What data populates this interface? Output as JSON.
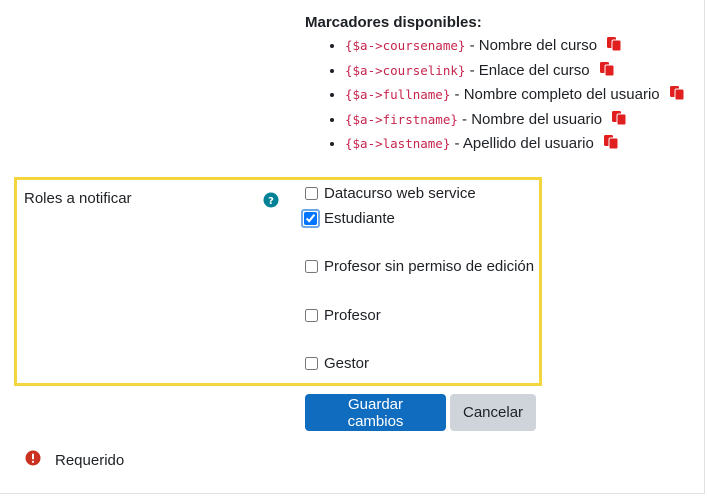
{
  "placeholders": {
    "title": "Marcadores disponibles:",
    "items": [
      {
        "code": "{$a->coursename}",
        "desc": " - Nombre del curso"
      },
      {
        "code": "{$a->courselink}",
        "desc": " - Enlace del curso"
      },
      {
        "code": "{$a->fullname}",
        "desc": " - Nombre completo del usuario"
      },
      {
        "code": "{$a->firstname}",
        "desc": " - Nombre del usuario"
      },
      {
        "code": "{$a->lastname}",
        "desc": " - Apellido del usuario"
      }
    ],
    "copy_icon": "copy-icon",
    "icon_color": "#e21f1f"
  },
  "roles": {
    "label": "Roles a notificar",
    "help_icon": "question-circle-icon",
    "help_color": "#008196",
    "highlight_color": "#f3d63d",
    "options": [
      {
        "label": "Datacurso web service",
        "checked": false
      },
      {
        "label": "Estudiante",
        "checked": true
      },
      {
        "label": "Profesor sin permiso de edición",
        "checked": false
      },
      {
        "label": "Profesor",
        "checked": false
      },
      {
        "label": "Gestor",
        "checked": false
      }
    ]
  },
  "actions": {
    "save_label": "Guardar cambios",
    "cancel_label": "Cancelar",
    "primary_color": "#0f6cbf"
  },
  "footer": {
    "required_label": "Requerido",
    "required_icon": "exclamation-circle-icon",
    "required_color": "#ca3120"
  }
}
